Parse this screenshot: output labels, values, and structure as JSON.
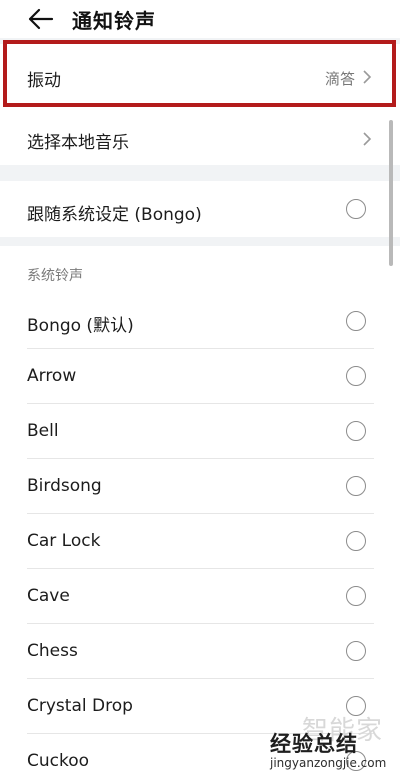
{
  "header": {
    "title": "通知铃声"
  },
  "vibration": {
    "label": "振动",
    "value": "滴答"
  },
  "local_music": {
    "label": "选择本地音乐"
  },
  "follow_system": {
    "label": "跟随系统设定 (Bongo)"
  },
  "section": {
    "title": "系统铃声"
  },
  "ringtones": [
    {
      "label": "Bongo (默认)"
    },
    {
      "label": "Arrow"
    },
    {
      "label": "Bell"
    },
    {
      "label": "Birdsong"
    },
    {
      "label": "Car Lock"
    },
    {
      "label": "Cave"
    },
    {
      "label": "Chess"
    },
    {
      "label": "Crystal Drop"
    },
    {
      "label": "Cuckoo"
    }
  ],
  "watermark": {
    "brand": "智能家",
    "text": "经验总结",
    "url": "jingyanzongjie.com"
  },
  "colors": {
    "highlight": "#b31b1b",
    "background": "#f1f3f5"
  }
}
